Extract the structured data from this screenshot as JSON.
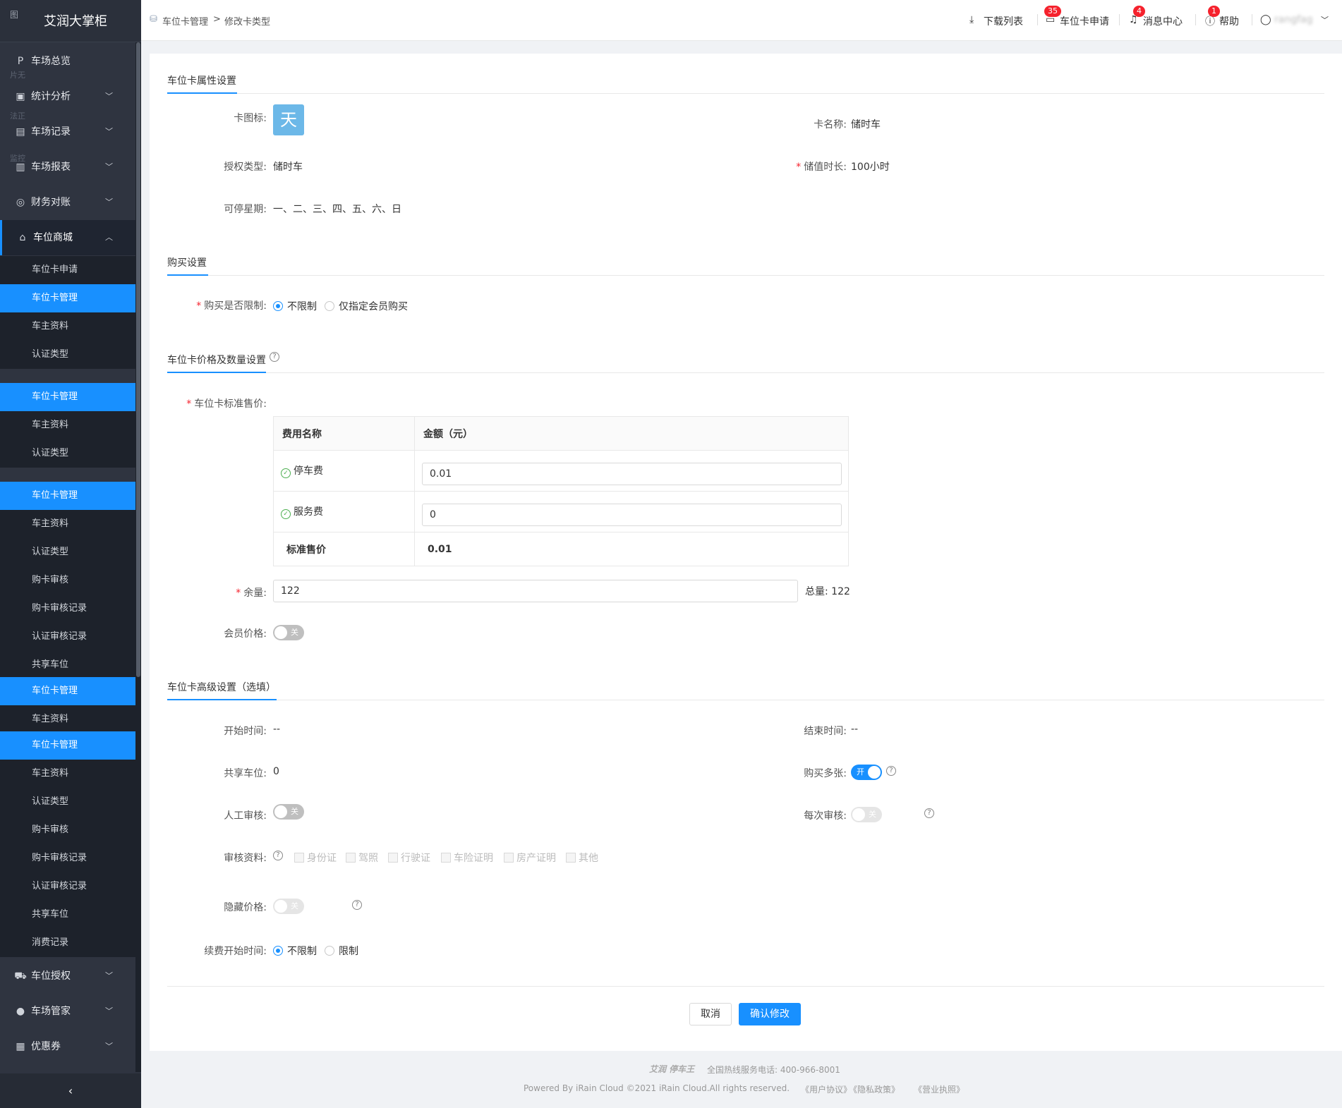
{
  "app": {
    "title": "艾润大掌柜",
    "logo_alt": "图"
  },
  "sidebar": {
    "menus": [
      {
        "label": "车场总览",
        "icon": "parking-icon"
      },
      {
        "label": "统计分析",
        "icon": "chart-icon"
      },
      {
        "label": "车场记录",
        "icon": "document-icon"
      },
      {
        "label": "车场报表",
        "icon": "report-icon"
      },
      {
        "label": "财务对账",
        "icon": "finance-icon"
      },
      {
        "label": "车位商城",
        "icon": "store-icon"
      }
    ],
    "ghost": [
      "片无",
      "法正",
      "监控"
    ],
    "subitems": [
      "车位卡申请",
      "车位卡管理",
      "车主资料",
      "认证类型",
      "车位卡管理",
      "车主资料",
      "认证类型",
      "车位卡管理",
      "车主资料",
      "认证类型",
      "购卡审核",
      "购卡审核记录",
      "认证审核记录",
      "共享车位",
      "车位卡管理",
      "车主资料",
      "车位卡管理",
      "车主资料",
      "认证类型",
      "购卡审核",
      "购卡审核记录",
      "认证审核记录",
      "共享车位",
      "消费记录"
    ],
    "bottom_menus": [
      {
        "label": "车位授权",
        "icon": "car-icon"
      },
      {
        "label": "车场管家",
        "icon": "user-icon"
      },
      {
        "label": "优惠券",
        "icon": "coupon-icon"
      }
    ],
    "collapse": "‹"
  },
  "header": {
    "breadcrumb": [
      "车位卡管理",
      ">",
      "修改卡类型"
    ],
    "download": "下载列表",
    "apply": "车位卡申请",
    "apply_badge": "35",
    "messages": "消息中心",
    "messages_badge": "4",
    "help": "帮助",
    "help_badge": "1",
    "user": "rangfag"
  },
  "sections": {
    "attr": "车位卡属性设置",
    "buy": "购买设置",
    "price": "车位卡价格及数量设置",
    "advanced": "车位卡高级设置（选填）"
  },
  "attr": {
    "icon_label": "卡图标:",
    "icon_char": "天",
    "name_label": "卡名称:",
    "name_value": "储时车",
    "auth_label": "授权类型:",
    "auth_value": "储时车",
    "duration_label": "储值时长:",
    "duration_value": "100小时",
    "weekdays_label": "可停星期:",
    "weekdays_value": "一、二、三、四、五、六、日"
  },
  "buy": {
    "limit_label": "购买是否限制:",
    "options": [
      "不限制",
      "仅指定会员购买"
    ]
  },
  "price": {
    "std_label": "车位卡标准售价:",
    "table_headers": [
      "费用名称",
      "金额（元）"
    ],
    "rows": [
      {
        "name": "停车费",
        "value": "0.01"
      },
      {
        "name": "服务费",
        "value": "0"
      }
    ],
    "total_label": "标准售价",
    "total_value": "0.01",
    "remain_label": "余量:",
    "remain_value": "122",
    "total_qty": "总量: 122",
    "member_label": "会员价格:",
    "member_toggle": "关"
  },
  "advanced": {
    "start_label": "开始时间:",
    "start_value": "--",
    "end_label": "结束时间:",
    "end_value": "--",
    "share_label": "共享车位:",
    "share_value": "0",
    "multi_label": "购买多张:",
    "multi_toggle": "开",
    "manual_label": "人工审核:",
    "manual_toggle": "关",
    "each_label": "每次审核:",
    "each_toggle": "关",
    "docs_label": "审核资料:",
    "docs": [
      "身份证",
      "驾照",
      "行驶证",
      "车险证明",
      "房产证明",
      "其他"
    ],
    "hide_label": "隐藏价格:",
    "hide_toggle": "关",
    "renew_label": "续费开始时间:",
    "renew_options": [
      "不限制",
      "限制"
    ]
  },
  "actions": {
    "cancel": "取消",
    "confirm": "确认修改"
  },
  "footer": {
    "brand": "艾润 停车王",
    "hotline": "全国热线服务电话: 400-966-8001",
    "copyright": "Powered By iRain Cloud ©2021 iRain Cloud.All rights reserved.",
    "links": [
      "《用户协议》",
      "《隐私政策》",
      "《营业执照》"
    ]
  }
}
